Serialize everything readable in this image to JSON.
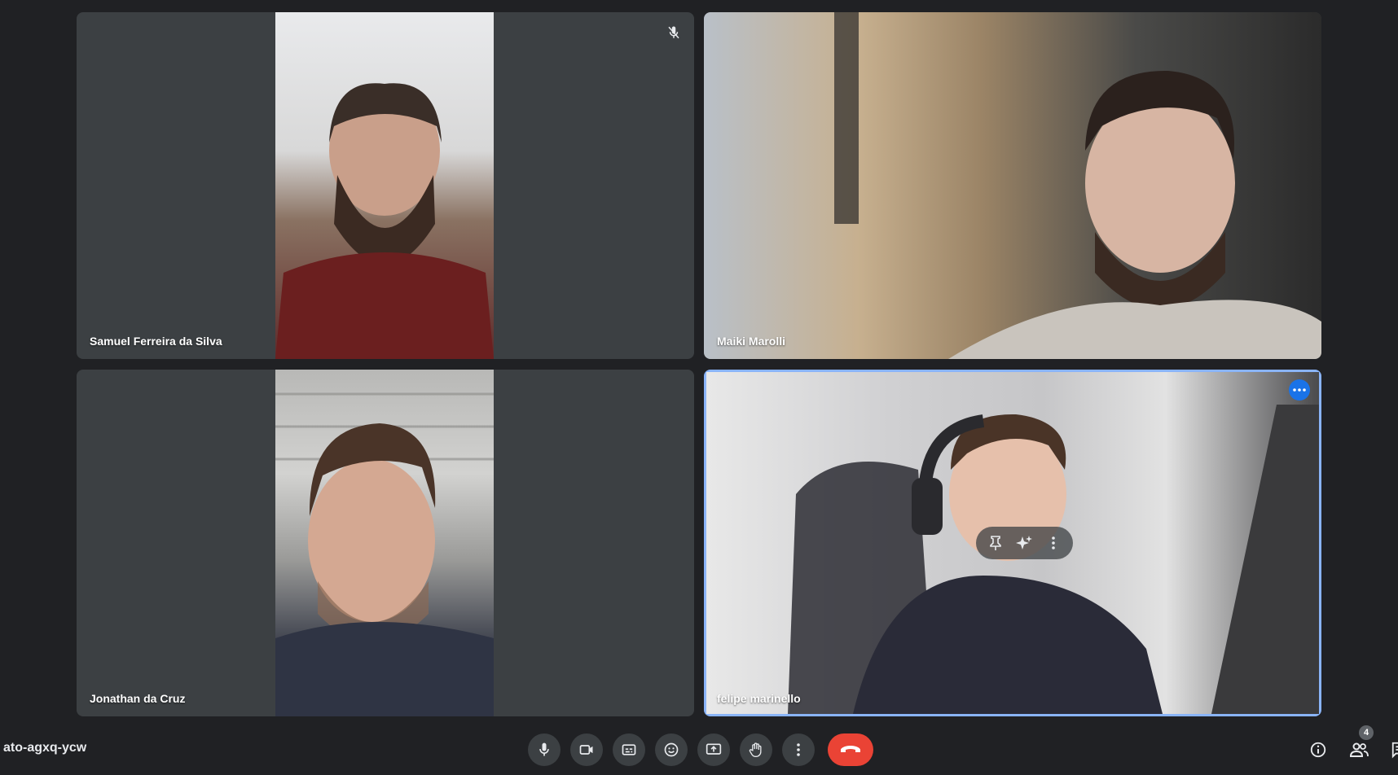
{
  "participants": [
    {
      "name": "Samuel Ferreira da Silva",
      "muted": true
    },
    {
      "name": "Maiki Marolli"
    },
    {
      "name": "Jonathan da Cruz"
    },
    {
      "name": "felipe marinello"
    }
  ],
  "meeting": {
    "code": "ato-agxq-ycw"
  },
  "controls": [
    "microphone",
    "camera",
    "captions",
    "emoji-reactions",
    "present-screen",
    "raise-hand",
    "more-options",
    "leave-call"
  ],
  "people_count": "4",
  "colors": {
    "background": "#202124",
    "tile": "#3c4043",
    "active_border": "#8ab4f8",
    "leave": "#ea4335",
    "accent": "#1a73e8"
  }
}
